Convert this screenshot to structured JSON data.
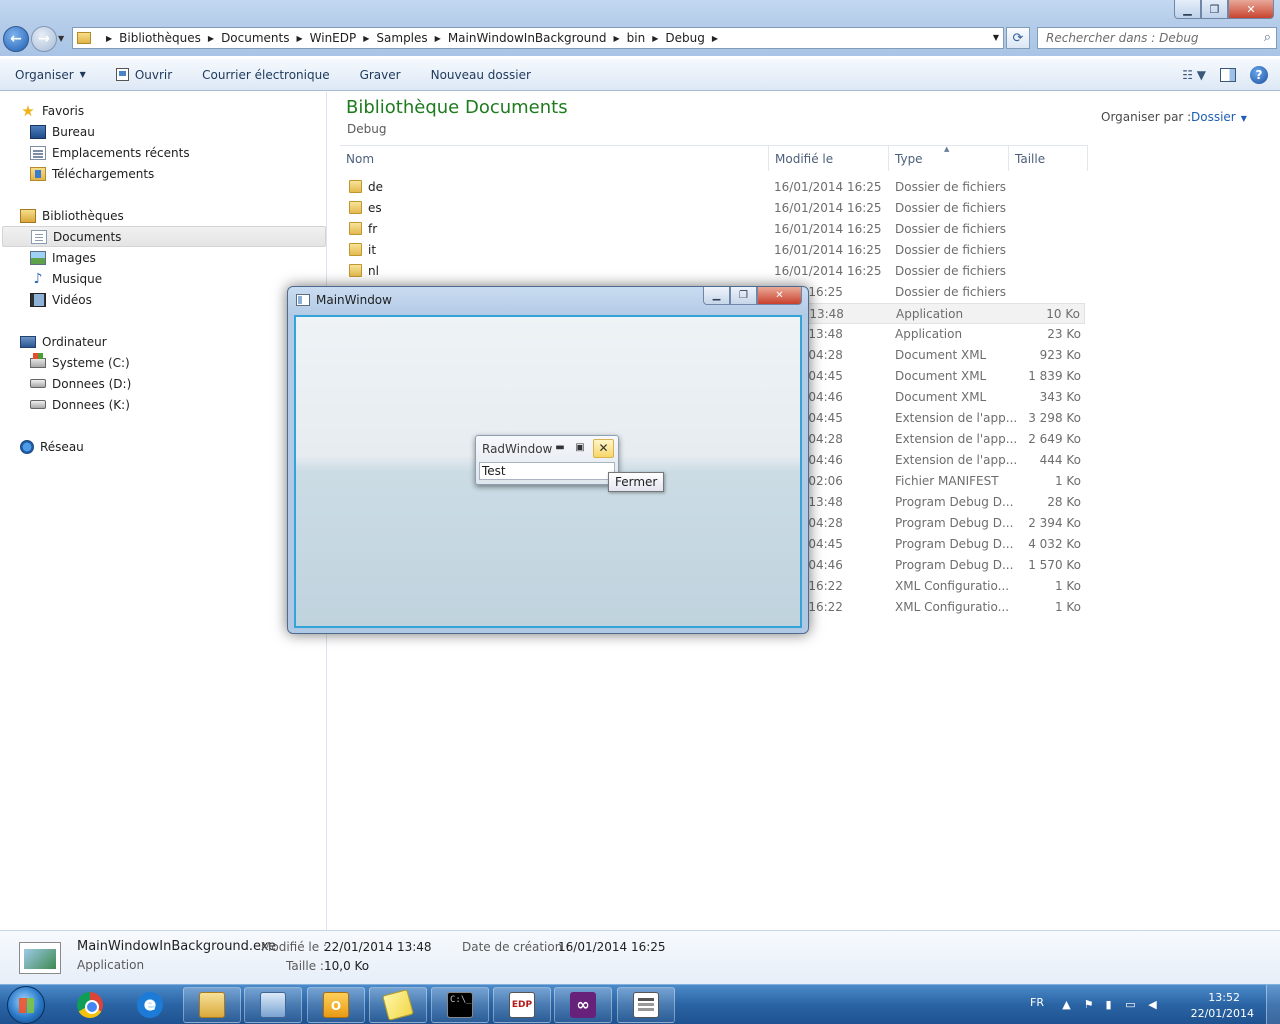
{
  "explorer": {
    "breadcrumb": [
      "Bibliothèques",
      "Documents",
      "WinEDP",
      "Samples",
      "MainWindowInBackground",
      "bin",
      "Debug"
    ],
    "search_placeholder": "Rechercher dans : Debug",
    "toolbar": {
      "organize": "Organiser",
      "open": "Ouvrir",
      "email": "Courrier électronique",
      "burn": "Graver",
      "new_folder": "Nouveau dossier"
    },
    "nav": {
      "favorites": "Favoris",
      "desktop": "Bureau",
      "recent": "Emplacements récents",
      "downloads": "Téléchargements",
      "libraries": "Bibliothèques",
      "documents": "Documents",
      "images": "Images",
      "music": "Musique",
      "videos": "Vidéos",
      "computer": "Ordinateur",
      "drive_c": "Systeme (C:)",
      "drive_d": "Donnees (D:)",
      "drive_k": "Donnees (K:)",
      "network": "Réseau"
    },
    "library_title": "Bibliothèque Documents",
    "library_subtitle": "Debug",
    "arrange_label": "Organiser par :",
    "arrange_value": "Dossier",
    "columns": {
      "name": "Nom",
      "modified": "Modifié le",
      "type": "Type",
      "size": "Taille"
    },
    "rows": [
      {
        "name": "de",
        "date": "16/01/2014 16:25",
        "type": "Dossier de fichiers",
        "size": ""
      },
      {
        "name": "es",
        "date": "16/01/2014 16:25",
        "type": "Dossier de fichiers",
        "size": ""
      },
      {
        "name": "fr",
        "date": "16/01/2014 16:25",
        "type": "Dossier de fichiers",
        "size": ""
      },
      {
        "name": "it",
        "date": "16/01/2014 16:25",
        "type": "Dossier de fichiers",
        "size": ""
      },
      {
        "name": "nl",
        "date": "16/01/2014 16:25",
        "type": "Dossier de fichiers",
        "size": ""
      },
      {
        "name": "",
        "date": "2014 16:25",
        "type": "Dossier de fichiers",
        "size": ""
      },
      {
        "name": "",
        "date": "2014 13:48",
        "type": "Application",
        "size": "10 Ko"
      },
      {
        "name": "",
        "date": "2014 13:48",
        "type": "Application",
        "size": "23 Ko"
      },
      {
        "name": "",
        "date": "2013 04:28",
        "type": "Document XML",
        "size": "923 Ko"
      },
      {
        "name": "",
        "date": "2013 04:45",
        "type": "Document XML",
        "size": "1 839 Ko"
      },
      {
        "name": "",
        "date": "2013 04:46",
        "type": "Document XML",
        "size": "343 Ko"
      },
      {
        "name": "",
        "date": "2013 04:45",
        "type": "Extension de l'app...",
        "size": "3 298 Ko"
      },
      {
        "name": "",
        "date": "2013 04:28",
        "type": "Extension de l'app...",
        "size": "2 649 Ko"
      },
      {
        "name": "",
        "date": "2013 04:46",
        "type": "Extension de l'app...",
        "size": "444 Ko"
      },
      {
        "name": "",
        "date": "2012 02:06",
        "type": "Fichier MANIFEST",
        "size": "1 Ko"
      },
      {
        "name": "",
        "date": "2014 13:48",
        "type": "Program Debug D...",
        "size": "28 Ko"
      },
      {
        "name": "",
        "date": "2013 04:28",
        "type": "Program Debug D...",
        "size": "2 394 Ko"
      },
      {
        "name": "",
        "date": "2013 04:45",
        "type": "Program Debug D...",
        "size": "4 032 Ko"
      },
      {
        "name": "",
        "date": "2013 04:46",
        "type": "Program Debug D...",
        "size": "1 570 Ko"
      },
      {
        "name": "",
        "date": "2014 16:22",
        "type": "XML Configuratio...",
        "size": "1 Ko"
      },
      {
        "name": "",
        "date": "2014 16:22",
        "type": "XML Configuratio...",
        "size": "1 Ko"
      }
    ],
    "details": {
      "file_name": "MainWindowInBackground.exe",
      "file_type": "Application",
      "modified_label": "Modifié le :",
      "modified_value": "22/01/2014 13:48",
      "size_label": "Taille :",
      "size_value": "10,0 Ko",
      "created_label": "Date de création :",
      "created_value": "16/01/2014 16:25"
    }
  },
  "main_window": {
    "title": "MainWindow"
  },
  "rad_window": {
    "title": "RadWindow",
    "content": "Test",
    "close_tooltip": "Fermer"
  },
  "taskbar": {
    "language": "FR",
    "time": "13:52",
    "date": "22/01/2014",
    "apps": [
      "chrome-icon",
      "internet-explorer-icon",
      "windows-explorer-icon",
      "network-connections-icon",
      "outlook-icon",
      "sticky-notes-icon",
      "command-prompt-icon",
      "micro-edp-icon",
      "visual-studio-icon",
      "application-icon"
    ]
  },
  "colors": {
    "library_title": "#1e7b1e",
    "link_blue": "#1e5fb4",
    "taskbar": "#2a64a4",
    "client_border": "#33a3d8"
  }
}
